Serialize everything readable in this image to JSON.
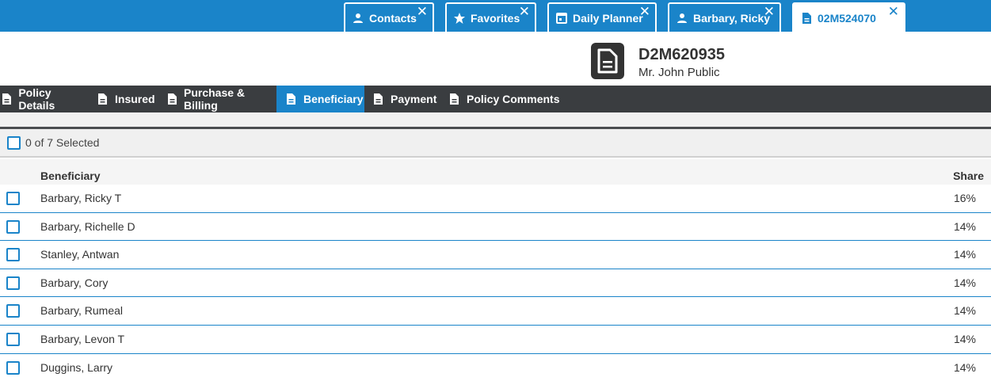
{
  "top_tabs": [
    {
      "label": "Contacts",
      "icon": "person-icon"
    },
    {
      "label": "Favorites",
      "icon": "star-icon"
    },
    {
      "label": "Daily Planner",
      "icon": "calendar-icon"
    },
    {
      "label": "Barbary, Ricky",
      "icon": "person-icon"
    },
    {
      "label": "02M524070",
      "icon": "document-icon",
      "active": true
    }
  ],
  "header": {
    "policy_id": "D2M620935",
    "owner": "Mr. John Public"
  },
  "section_tabs": [
    {
      "label": "Policy Details"
    },
    {
      "label": "Insured"
    },
    {
      "label": "Purchase & Billing"
    },
    {
      "label": "Beneficiary",
      "active": true
    },
    {
      "label": "Payment"
    },
    {
      "label": "Policy Comments"
    }
  ],
  "selection": {
    "text": "0 of 7 Selected"
  },
  "table": {
    "headers": {
      "beneficiary": "Beneficiary",
      "share": "Share"
    },
    "rows": [
      {
        "name": "Barbary, Ricky T",
        "share": "16%"
      },
      {
        "name": "Barbary, Richelle D",
        "share": "14%"
      },
      {
        "name": "Stanley, Antwan",
        "share": "14%"
      },
      {
        "name": "Barbary, Cory",
        "share": "14%"
      },
      {
        "name": "Barbary, Rumeal",
        "share": "14%"
      },
      {
        "name": "Barbary, Levon T",
        "share": "14%"
      },
      {
        "name": "Duggins, Larry",
        "share": "14%"
      }
    ]
  },
  "colors": {
    "accent": "#1a84c9",
    "nav_bg": "#3a3d40"
  }
}
